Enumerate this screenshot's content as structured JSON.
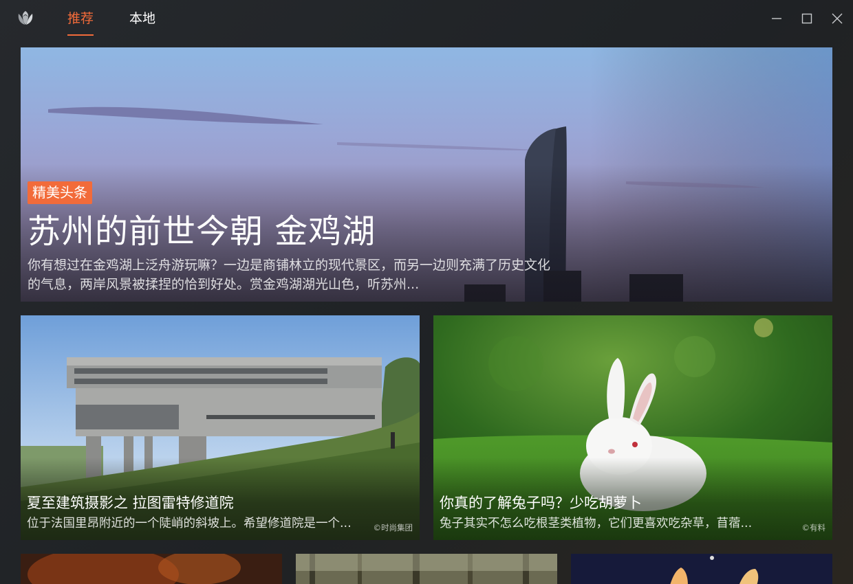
{
  "colors": {
    "accent": "#f26b3a",
    "badge_bg": "#f26b3a",
    "window_bg": "#202124"
  },
  "titlebar": {
    "logo_icon": "tulip-logo-icon",
    "tabs": [
      {
        "label": "推荐",
        "active": true
      },
      {
        "label": "本地",
        "active": false
      }
    ],
    "window_controls": [
      "minimize-icon",
      "maximize-icon",
      "close-icon"
    ]
  },
  "hero": {
    "badge": "精美头条",
    "title": "苏州的前世今朝 金鸡湖",
    "description": "你有想过在金鸡湖上泛舟游玩嘛？一边是商铺林立的现代景区，而另一边则充满了历史文化的气息，两岸风景被揉捏的恰到好处。赏金鸡湖湖光山色，听苏州..."
  },
  "cards": [
    {
      "title": "夏至建筑摄影之 拉图雷特修道院",
      "description": "位于法国里昂附近的一个陡峭的斜坡上。希望修道院是一个...",
      "source": "©时尚集团"
    },
    {
      "title": "你真的了解兔子吗？少吃胡萝卜",
      "description": "兔子其实不怎么吃根茎类植物，它们更喜欢吃杂草，苜蓿...",
      "source": "©有料"
    }
  ]
}
